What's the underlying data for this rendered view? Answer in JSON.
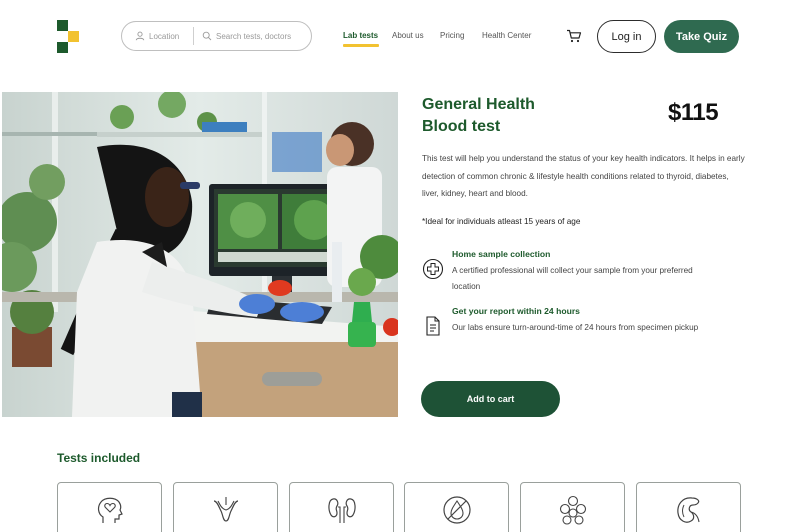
{
  "header": {
    "search": {
      "location_placeholder": "Location",
      "query_placeholder": "Search tests, doctors"
    },
    "nav": [
      {
        "label": "Lab tests",
        "active": true
      },
      {
        "label": "About us",
        "active": false
      },
      {
        "label": "Pricing",
        "active": false
      },
      {
        "label": "Health Center",
        "active": false
      }
    ],
    "login_label": "Log in",
    "quiz_label": "Take Quiz",
    "cart_icon": "cart-icon"
  },
  "colors": {
    "brand_green": "#1d5a2c",
    "accent_yellow": "#f2c230",
    "button_green": "#2f6a50"
  },
  "product": {
    "title": "General Health Blood test",
    "price": "$115",
    "description": "This test will help you understand the status of your key health indicators. It helps in early detection of common chronic & lifestyle health conditions related to thyroid, diabetes, liver, kidney, heart and blood.",
    "ideal_for": "*Ideal for individuals  atleast 15 years of age",
    "features": [
      {
        "icon": "medical-cross-icon",
        "title": "Home sample collection",
        "description": "A certified professional will collect your sample from your preferred location"
      },
      {
        "icon": "report-document-icon",
        "title": "Get your report within 24 hours",
        "description": "Our labs ensure turn-around-time of 24 hours from specimen pickup"
      }
    ],
    "add_to_cart_label": "Add to cart"
  },
  "tests_included": {
    "title": "Tests included",
    "icons": [
      "head-heart-icon",
      "thyroid-icon",
      "kidneys-icon",
      "no-blood-drop-icon",
      "cells-icon",
      "kidney-icon"
    ]
  }
}
